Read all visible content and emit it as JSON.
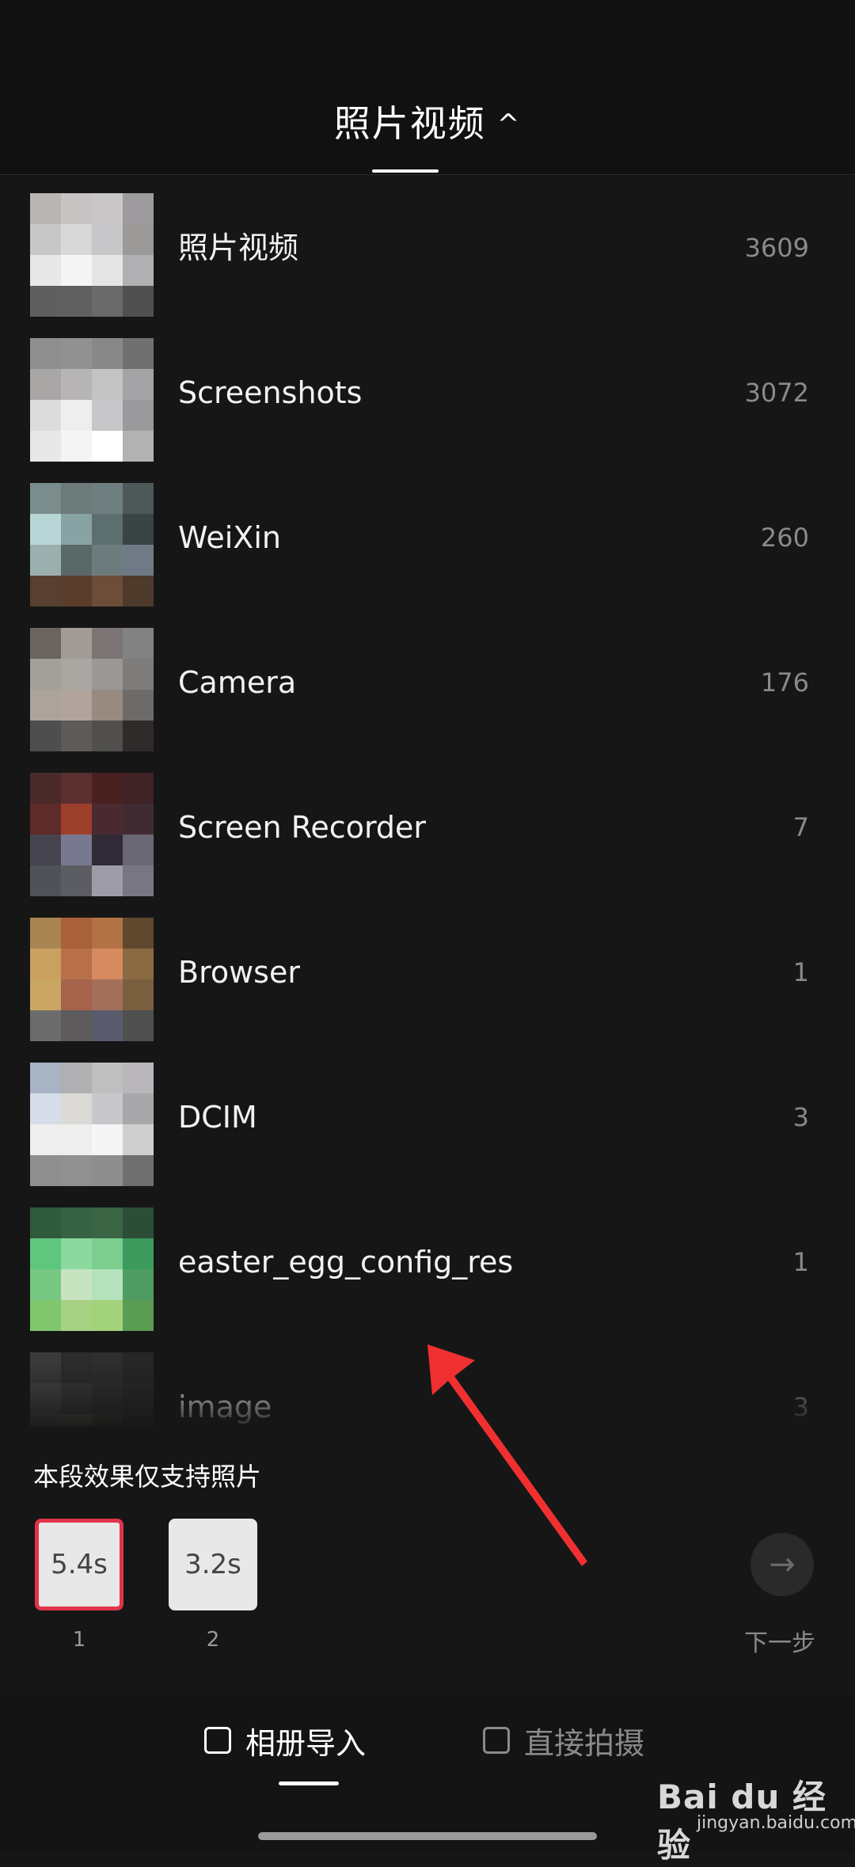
{
  "header": {
    "title": "照片视频",
    "chevron_icon": "chevron-up-icon"
  },
  "albums": [
    {
      "name": "照片视频",
      "count": "3609",
      "thumb": [
        "#b8b5b3",
        "#c7c3c2",
        "#c9c7c8",
        "#9d9b9d",
        "#c8c7c7",
        "#d9d8d9",
        "#c7c6c8",
        "#9c9999",
        "#e8e8e8",
        "#f5f5f5",
        "#e5e5e6",
        "#b0afb1",
        "#5f5f60",
        "#606061",
        "#6a6a6b",
        "#505051"
      ]
    },
    {
      "name": "Screenshots",
      "count": "3072",
      "thumb": [
        "#8f8f8f",
        "#919191",
        "#888889",
        "#707071",
        "#a9a6a6",
        "#b7b4b6",
        "#c4c4c5",
        "#a4a3a5",
        "#dcdcdc",
        "#eeeeee",
        "#c7c7c9",
        "#9a999b",
        "#e8e8e8",
        "#f4f4f4",
        "#ffffff",
        "#b2b2b2"
      ]
    },
    {
      "name": "WeiXin",
      "count": "260",
      "thumb": [
        "#7a8c8c",
        "#6d7a7a",
        "#6f7f7f",
        "#4e5858",
        "#b8d6d6",
        "#87a3a3",
        "#5c6e6e",
        "#3b4444",
        "#9bb0ae",
        "#5a6868",
        "#6c7c7c",
        "#6f7a86",
        "#574030",
        "#5a3e2b",
        "#6d4c38",
        "#4d3a2b"
      ]
    },
    {
      "name": "Camera",
      "count": "176",
      "thumb": [
        "#6b6560",
        "#a29c96",
        "#7a7574",
        "#828282",
        "#a39f9b",
        "#aaa6a2",
        "#9a9795",
        "#7e7d7c",
        "#aca39a",
        "#b2a49c",
        "#978b80",
        "#6d6b69",
        "#4e4e4e",
        "#5d5a58",
        "#514f4e",
        "#2f2b2b"
      ]
    },
    {
      "name": "Screen Recorder",
      "count": "7",
      "thumb": [
        "#4a2a2a",
        "#5c3030",
        "#482020",
        "#3e2226",
        "#5e2a2a",
        "#9c3f2c",
        "#4a2a30",
        "#3f2c33",
        "#45444e",
        "#787990",
        "#2f2a36",
        "#6a6875",
        "#4f5256",
        "#5b5d62",
        "#9f9caa",
        "#787680"
      ]
    },
    {
      "name": "Browser",
      "count": "1",
      "thumb": [
        "#a88553",
        "#a8613b",
        "#b27245",
        "#60482f",
        "#c9a05e",
        "#b7704a",
        "#d78a60",
        "#8a6a42",
        "#c9a763",
        "#a5634c",
        "#a3705c",
        "#7a5f3f",
        "#6c6c6c",
        "#5e5b5c",
        "#5a5c6e",
        "#505050"
      ]
    },
    {
      "name": "DCIM",
      "count": "3",
      "thumb": [
        "#a8b4c4",
        "#b0b0b3",
        "#bfbfc0",
        "#b9b7bb",
        "#d6dde8",
        "#dcdad6",
        "#c8c8cc",
        "#a8a8ab",
        "#eeeeee",
        "#eeeeee",
        "#f5f5f5",
        "#cfcfcf",
        "#8f8f8f",
        "#919191",
        "#8e8e8e",
        "#6f6f6f"
      ]
    },
    {
      "name": "easter_egg_config_res",
      "count": "1",
      "thumb": [
        "#2f5a3c",
        "#356242",
        "#3a6444",
        "#2c4d37",
        "#5fc67d",
        "#8cd99f",
        "#7ccd8e",
        "#3c9a5d",
        "#76c882",
        "#c7e3c0",
        "#b3e2bd",
        "#4e9c62",
        "#80c76d",
        "#a7d183",
        "#a2d37b",
        "#5a9c52"
      ]
    },
    {
      "name": "image",
      "count": "3",
      "thumb": [
        "#3a3a3a",
        "#2c2c2c",
        "#2e2e2e",
        "#262626",
        "#484848",
        "#3a3a3a",
        "#303030",
        "#2a2a2a",
        "#525252",
        "#5a5a52",
        "#3e3e36",
        "#2a2a28",
        "#3c3c3c",
        "#484848",
        "#353535",
        "#2c2c2c"
      ]
    }
  ],
  "notice": "本段效果仅支持照片",
  "clips": [
    {
      "duration": "5.4s",
      "index": "1",
      "selected": true
    },
    {
      "duration": "3.2s",
      "index": "2",
      "selected": false
    }
  ],
  "next": {
    "label": "下一步",
    "icon": "arrow-right-icon"
  },
  "tabs": [
    {
      "label": "相册导入",
      "icon": "album-icon",
      "active": true
    },
    {
      "label": "直接拍摄",
      "icon": "camera-icon",
      "active": false
    }
  ],
  "watermark": {
    "brand": "Bai du 经验",
    "url": "jingyan.baidu.com"
  },
  "colors": {
    "selected_border": "#e0334b",
    "annotation_arrow": "#f03030",
    "background": "#161616"
  }
}
